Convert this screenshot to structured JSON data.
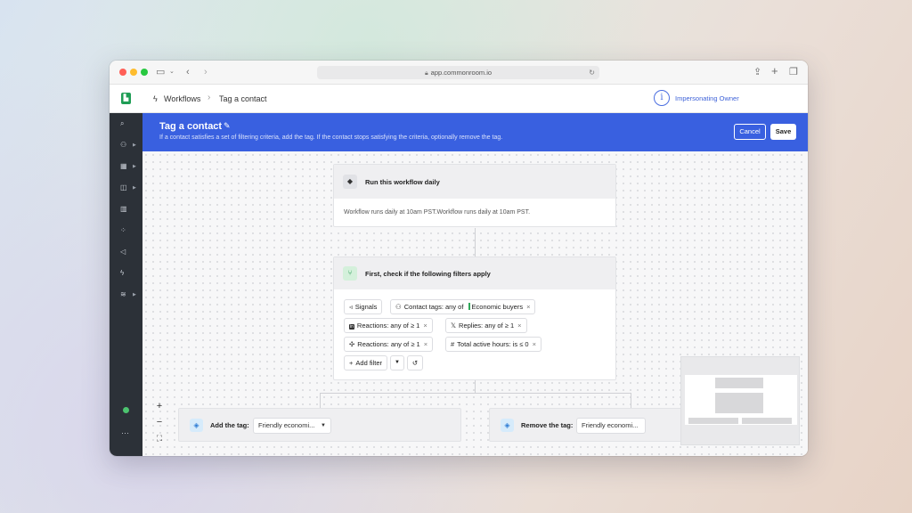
{
  "browser": {
    "url": "app.commonroom.io",
    "icons": [
      "sidebar-toggle-icon",
      "chevron-down-icon",
      "back-icon",
      "forward-icon",
      "lock-icon",
      "reload-icon",
      "share-icon",
      "new-tab-icon",
      "tabs-icon"
    ]
  },
  "header": {
    "breadcrumb_root": "Workflows",
    "breadcrumb_current": "Tag a contact",
    "impersonating": "Impersonating Owner",
    "info_glyph": "i"
  },
  "page": {
    "title": "Tag a contact",
    "subtitle": "If a contact satisfies a set of filtering criteria, add the tag. If the contact stops satisfying the criteria, optionally remove the tag.",
    "cancel_label": "Cancel",
    "save_label": "Save"
  },
  "trigger": {
    "title": "Run this workflow daily",
    "body": "Workflow runs daily at 10am PST.Workflow runs daily at 10am PST."
  },
  "filters": {
    "title": "First, check if the following filters apply",
    "chips": {
      "signals": "Signals",
      "contact_tags": "Contact tags: any of",
      "contact_tags_value": "Economic buyers",
      "reactions_linkedin": "Reactions: any of ≥ 1",
      "replies_x": "Replies: any of ≥ 1",
      "reactions_slack": "Reactions: any of ≥ 1",
      "active_hours": "Total active hours: is ≤ 0"
    },
    "add_filter": "Add filter",
    "remove_glyph": "×"
  },
  "actions": {
    "add_tag_label": "Add the tag:",
    "add_tag_value": "Friendly economi...",
    "remove_tag_label": "Remove the tag:",
    "remove_tag_value": "Friendly economi..."
  },
  "zoom": {
    "in": "+",
    "out": "−"
  },
  "colors": {
    "accent": "#3960e0",
    "sidebar": "#2c3138",
    "status_green": "#4cc36f",
    "tag_green": "#2fa85a"
  }
}
